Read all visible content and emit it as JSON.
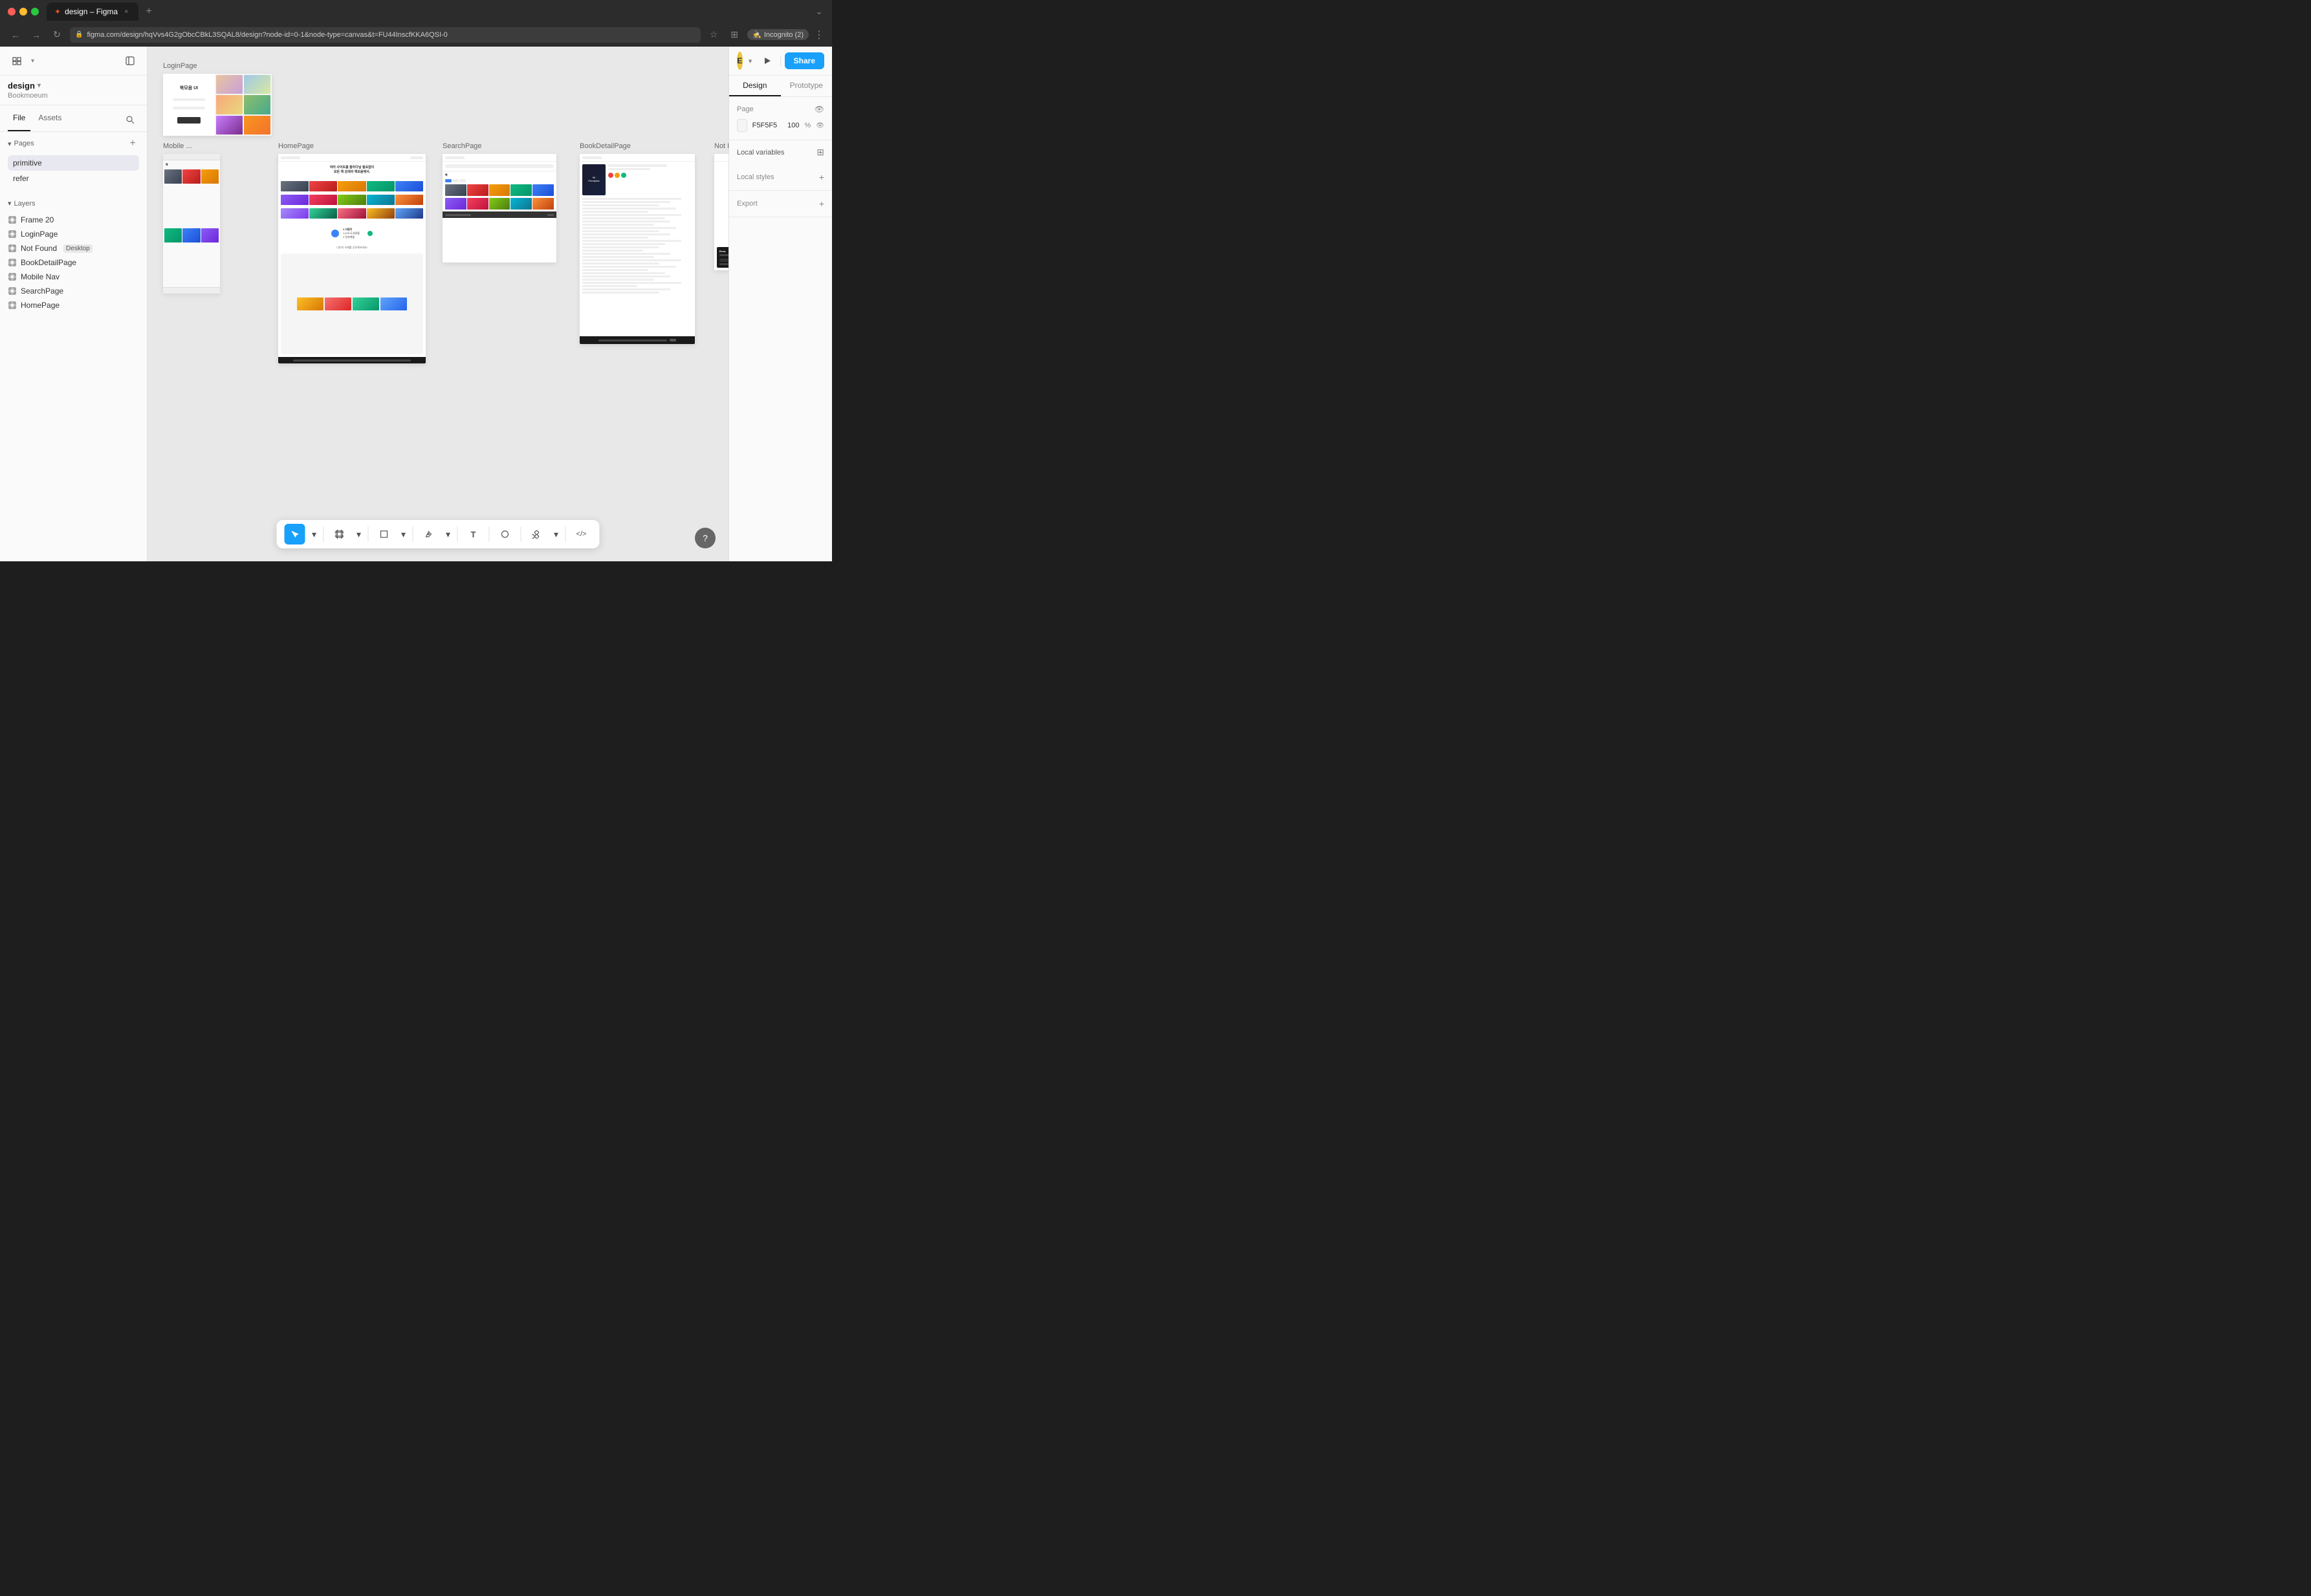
{
  "browser": {
    "tab_label": "design – Figma",
    "url": "figma.com/design/hqVvs4G2gObcCBkL3SQAL8/design?node-id=0-1&node-type=canvas&t=FU44InscfKKA6QSI-0",
    "new_tab_symbol": "+",
    "nav_back": "←",
    "nav_forward": "→",
    "nav_refresh": "↻",
    "bookmark_icon": "☆",
    "extensions_icon": "⊞",
    "incognito_label": "Incognito (2)",
    "more_icon": "⋮"
  },
  "figma_icon": "✦",
  "toolbar_left": {
    "grid_icon": "⊞",
    "panel_icon": "⊟"
  },
  "project": {
    "name": "design",
    "org": "Bookmoeum",
    "chevron": "▾"
  },
  "sidebar_tabs": {
    "file": "File",
    "assets": "Assets"
  },
  "search": {
    "placeholder": "Search"
  },
  "pages": {
    "label": "Pages",
    "add_symbol": "+",
    "items": [
      {
        "name": "primitive",
        "active": true
      },
      {
        "name": "refer",
        "active": false
      }
    ]
  },
  "layers": {
    "label": "Layers",
    "items": [
      {
        "name": "Frame 20",
        "type": "frame"
      },
      {
        "name": "LoginPage",
        "type": "frame"
      },
      {
        "name": "Not Found",
        "type": "frame",
        "badge": "Desktop"
      },
      {
        "name": "BookDetailPage",
        "type": "frame"
      },
      {
        "name": "Mobile Nav",
        "type": "frame"
      },
      {
        "name": "SearchPage",
        "type": "frame"
      },
      {
        "name": "HomePage",
        "type": "frame"
      }
    ]
  },
  "canvas": {
    "bg_color": "#e8e8e8",
    "frames": [
      {
        "id": "login",
        "label": "LoginPage"
      },
      {
        "id": "mobile",
        "label": "Mobile ..."
      },
      {
        "id": "homepage",
        "label": "HomePage"
      },
      {
        "id": "search",
        "label": "SearchPage"
      },
      {
        "id": "bookdetail",
        "label": "BookDetailPage"
      },
      {
        "id": "notfound",
        "label": "Not Found"
      }
    ]
  },
  "toolbar": {
    "select_tool": "↖",
    "frame_tool": "⊡",
    "rect_tool": "□",
    "pen_tool": "✒",
    "text_tool": "T",
    "ellipse_tool": "○",
    "component_tool": "❖",
    "code_tool": "</>",
    "chevron_down": "▾"
  },
  "help": {
    "label": "?"
  },
  "right_panel": {
    "user_initial": "E",
    "play_icon": "▶",
    "share_label": "Share",
    "tabs": {
      "design": "Design",
      "prototype": "Prototype"
    },
    "page_section": {
      "label": "Page",
      "eye_icon": "👁",
      "color_value": "F5F5F5",
      "opacity_value": "100",
      "pct": "%",
      "eye_icon2": "👁"
    },
    "local_variables": {
      "label": "Local variables",
      "icon": "⊞"
    },
    "local_styles": {
      "label": "Local styles",
      "add_icon": "+"
    },
    "export": {
      "label": "Export",
      "add_icon": "+"
    }
  }
}
